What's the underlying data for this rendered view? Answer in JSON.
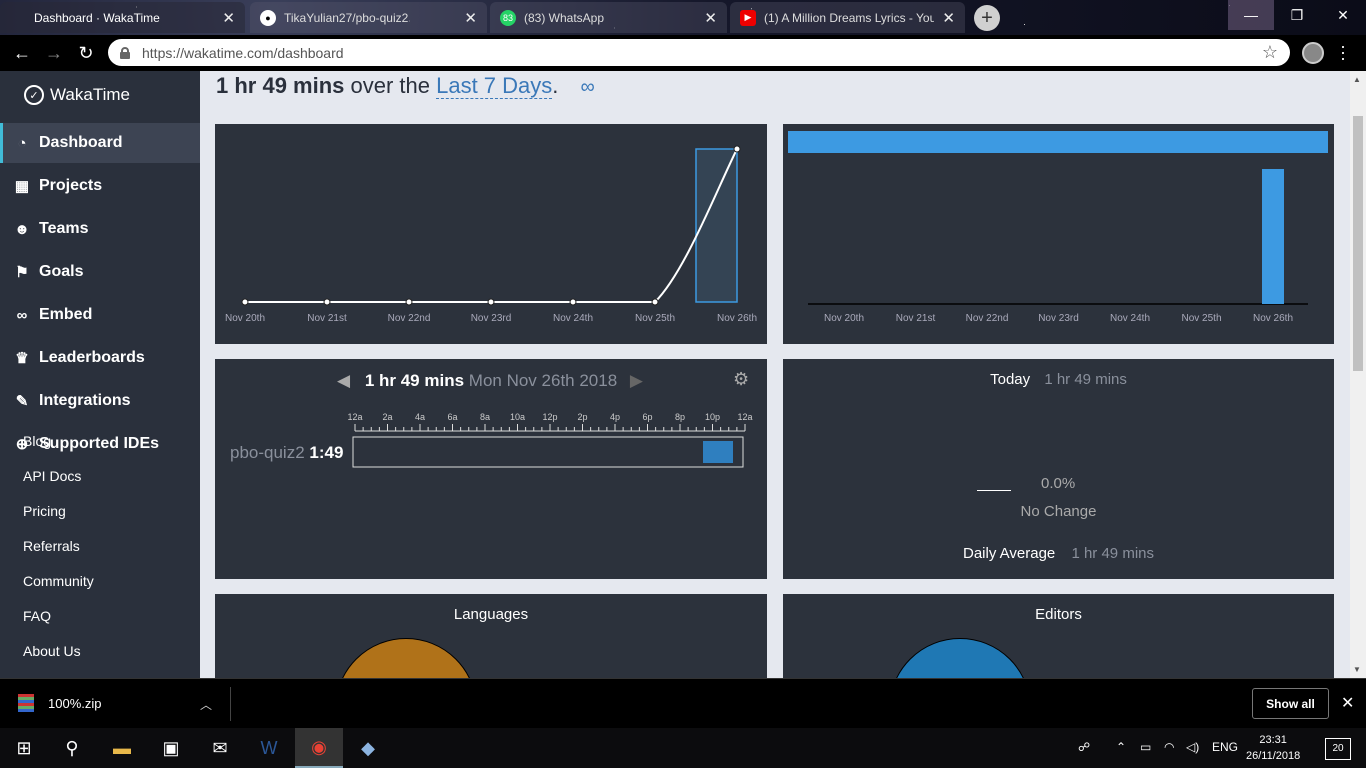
{
  "browser": {
    "tabs": [
      {
        "title": "Dashboard · WakaTime",
        "active": true
      },
      {
        "title": "TikaYulian27/pbo-quiz2",
        "active": false
      },
      {
        "title": "(83) WhatsApp",
        "active": false,
        "badge": "83"
      },
      {
        "title": "(1) A Million Dreams Lyrics - You",
        "active": false
      }
    ],
    "url": "https://wakatime.com/dashboard"
  },
  "sidebar": {
    "brand": "WakaTime",
    "items": [
      {
        "label": "Dashboard",
        "icon": "dashboard-icon"
      },
      {
        "label": "Projects",
        "icon": "grid-icon"
      },
      {
        "label": "Teams",
        "icon": "users-icon"
      },
      {
        "label": "Goals",
        "icon": "flag-icon"
      },
      {
        "label": "Embed",
        "icon": "link-icon"
      },
      {
        "label": "Leaderboards",
        "icon": "trophy-icon"
      },
      {
        "label": "Integrations",
        "icon": "wrench-icon"
      },
      {
        "label": "Supported IDEs",
        "icon": "plus-circle-icon"
      }
    ],
    "overlap_text": "Blog",
    "links": [
      "API Docs",
      "Pricing",
      "Referrals",
      "Community",
      "FAQ",
      "About Us"
    ]
  },
  "headline": {
    "total": "1 hr 49 mins",
    "middle": " over the ",
    "range": "Last 7 Days",
    "period": "."
  },
  "chart_data": [
    {
      "type": "area",
      "categories": [
        "Nov 20th",
        "Nov 21st",
        "Nov 22nd",
        "Nov 23rd",
        "Nov 24th",
        "Nov 25th",
        "Nov 26th"
      ],
      "values": [
        0,
        0,
        0,
        0,
        0,
        0,
        109
      ]
    },
    {
      "type": "bar",
      "categories": [
        "Nov 20th",
        "Nov 21st",
        "Nov 22nd",
        "Nov 23rd",
        "Nov 24th",
        "Nov 25th",
        "Nov 26th"
      ],
      "values": [
        0,
        0,
        0,
        0,
        0,
        0,
        109
      ]
    }
  ],
  "day_panel": {
    "total": "1 hr 49 mins",
    "date": "Mon Nov 26th 2018",
    "hours": [
      "12a",
      "2a",
      "4a",
      "6a",
      "8a",
      "10a",
      "12p",
      "2p",
      "4p",
      "6p",
      "8p",
      "10p",
      "12a"
    ],
    "project": "pbo-quiz2",
    "project_time": "1:49"
  },
  "today_panel": {
    "today_label": "Today",
    "today_value": "1 hr 49 mins",
    "change_pct": "0.0%",
    "change_text": "No Change",
    "avg_label": "Daily Average",
    "avg_value": "1 hr 49 mins"
  },
  "bottom_panels": {
    "languages": "Languages",
    "editors": "Editors"
  },
  "colors": {
    "bar": "#3d9ae2",
    "lang_slice": "#b07219",
    "editor_slice": "#1f78b4",
    "accent": "#41bcd8"
  },
  "downloads": {
    "file": "100%.zip",
    "show_all": "Show all"
  },
  "taskbar": {
    "lang": "ENG",
    "time": "23:31",
    "date": "26/11/2018",
    "notifications": "20"
  }
}
